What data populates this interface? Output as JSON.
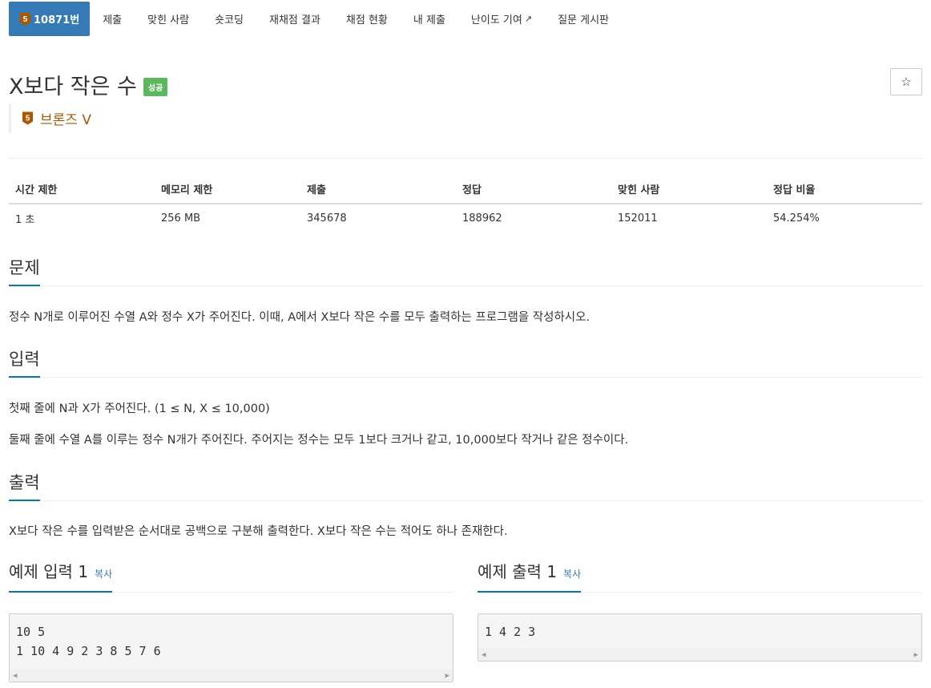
{
  "tabs": {
    "problem_number": "10871번",
    "tier_number": "5",
    "items": [
      "제출",
      "맞힌 사람",
      "숏코딩",
      "재채점 결과",
      "채점 현황",
      "내 제출",
      "난이도 기여",
      "질문 게시판"
    ]
  },
  "problem": {
    "title": "X보다 작은 수",
    "status_label": "성공",
    "star": "☆",
    "tier_number": "5",
    "tier_name": "브론즈 V",
    "tier_color": "#ad5600"
  },
  "info_table": {
    "headers": [
      "시간 제한",
      "메모리 제한",
      "제출",
      "정답",
      "맞힌 사람",
      "정답 비율"
    ],
    "values": [
      "1 초",
      "256 MB",
      "345678",
      "188962",
      "152011",
      "54.254%"
    ]
  },
  "sections": {
    "description": {
      "heading": "문제",
      "text": "정수 N개로 이루어진 수열 A와 정수 X가 주어진다. 이때, A에서 X보다 작은 수를 모두 출력하는 프로그램을 작성하시오."
    },
    "input": {
      "heading": "입력",
      "lines": [
        "첫째 줄에 N과 X가 주어진다. (1 ≤ N, X ≤ 10,000)",
        "둘째 줄에 수열 A를 이루는 정수 N개가 주어진다. 주어지는 정수는 모두 1보다 크거나 같고, 10,000보다 작거나 같은 정수이다."
      ]
    },
    "output": {
      "heading": "출력",
      "text": "X보다 작은 수를 입력받은 순서대로 공백으로 구분해 출력한다. X보다 작은 수는 적어도 하나 존재한다."
    }
  },
  "samples": {
    "input": {
      "heading": "예제 입력 1",
      "copy_label": "복사",
      "lines": [
        "10 5",
        "1 10 4 9 2 3 8 5 7 6"
      ]
    },
    "output": {
      "heading": "예제 출력 1",
      "copy_label": "복사",
      "lines": [
        "1 4 2 3"
      ]
    }
  },
  "colors": {
    "primary": "#337ab7",
    "success": "#5cb85c",
    "section_underline": "#0076c0"
  }
}
